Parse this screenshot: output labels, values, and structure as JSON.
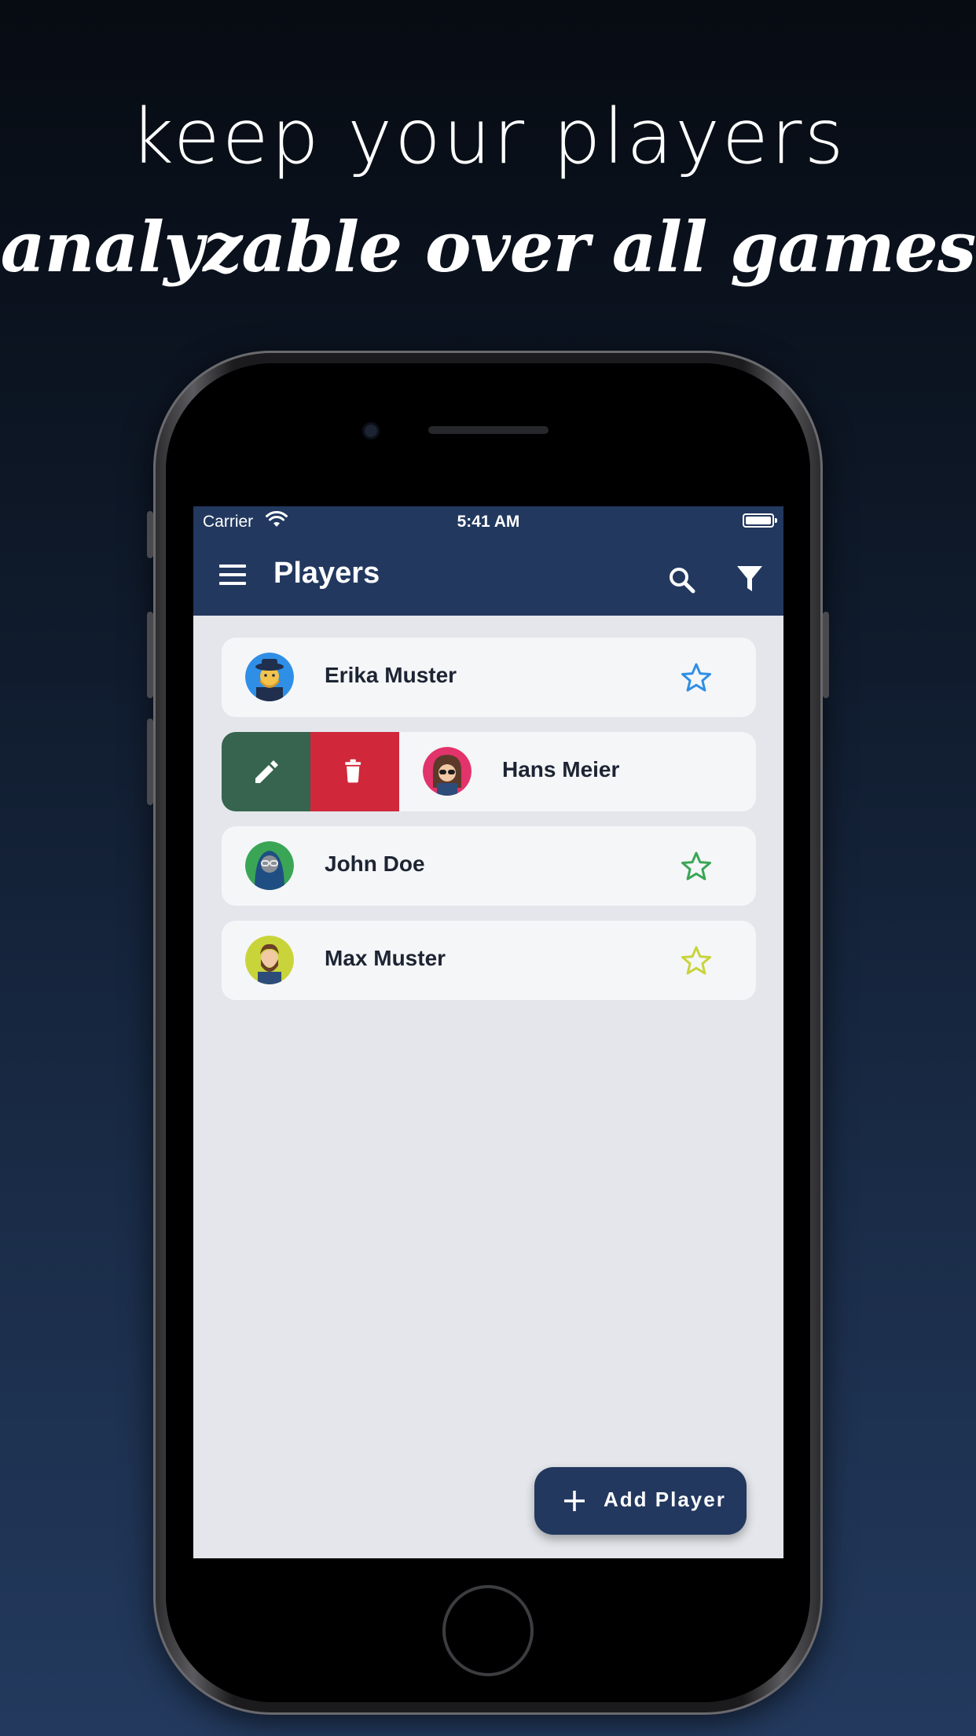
{
  "promo": {
    "line1": "keep your players",
    "line2": "analyzable over all games"
  },
  "status_bar": {
    "carrier": "Carrier",
    "time": "5:41 AM"
  },
  "app_bar": {
    "title": "Players",
    "icons": [
      "menu-icon",
      "search-icon",
      "filter-icon"
    ]
  },
  "players": [
    {
      "name": "Erika Muster",
      "star_color": "#2f8fe6",
      "avatar_bg": "#2f8fe6"
    },
    {
      "name": "Hans Meier",
      "star_color": "",
      "avatar_bg": "#e2336b",
      "swiped": true
    },
    {
      "name": "John Doe",
      "star_color": "#3aa655",
      "avatar_bg": "#3aa655"
    },
    {
      "name": "Max Muster",
      "star_color": "#c8d43a",
      "avatar_bg": "#c8d43a"
    }
  ],
  "swipe_actions": {
    "edit_color": "#36644e",
    "delete_color": "#d0283a"
  },
  "fab": {
    "label": "Add Player"
  },
  "colors": {
    "primary": "#22385f",
    "background": "#e4e6eb",
    "card": "#f5f6f8"
  }
}
